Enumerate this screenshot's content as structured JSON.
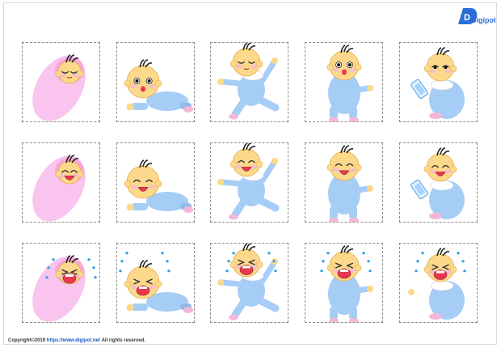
{
  "footer": {
    "copyright": "Copyright©2019",
    "site": "https://www.digipot.net",
    "rights": "All rights reserved."
  },
  "logo": {
    "text": "Digipot",
    "icon": "digipot-logo"
  },
  "colors": {
    "skin": "#fcd98a",
    "onesie": "#a6cdf5",
    "blanket": "#f9c4ee",
    "pink": "#f5b6d9",
    "tear": "#2ba4ea",
    "mouth": "#e8384f"
  },
  "cells": [
    {
      "pose": "swaddled",
      "mood": "sleeping"
    },
    {
      "pose": "crawling",
      "mood": "surprised"
    },
    {
      "pose": "walking",
      "mood": "sleeping"
    },
    {
      "pose": "sitting",
      "mood": "surprised"
    },
    {
      "pose": "bottle",
      "mood": "drinking"
    },
    {
      "pose": "swaddled",
      "mood": "happy"
    },
    {
      "pose": "crawling",
      "mood": "happy"
    },
    {
      "pose": "walking",
      "mood": "happy"
    },
    {
      "pose": "sitting",
      "mood": "happy"
    },
    {
      "pose": "bottle",
      "mood": "happy"
    },
    {
      "pose": "swaddled",
      "mood": "crying"
    },
    {
      "pose": "crawling",
      "mood": "crying"
    },
    {
      "pose": "walking",
      "mood": "crying"
    },
    {
      "pose": "sitting",
      "mood": "crying"
    },
    {
      "pose": "bottle",
      "mood": "crying"
    }
  ]
}
